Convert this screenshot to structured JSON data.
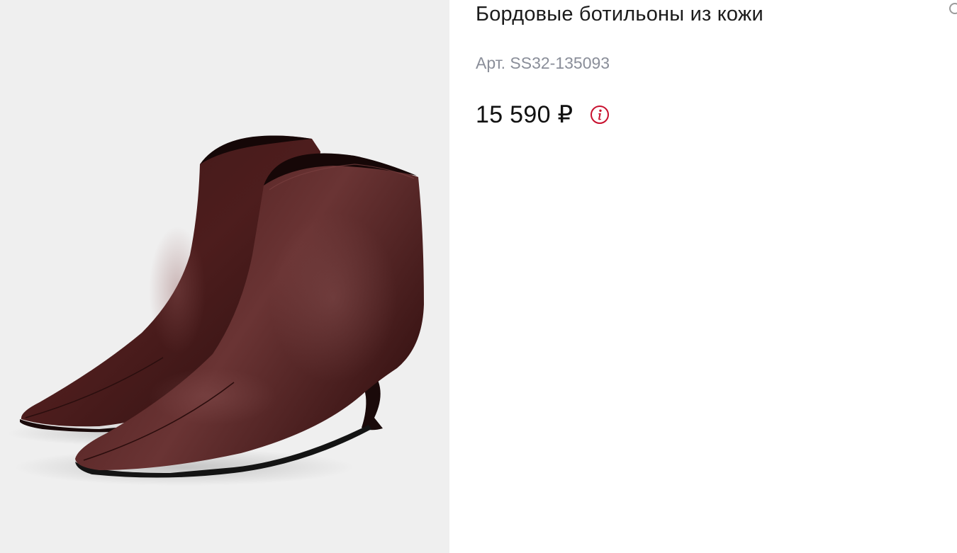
{
  "product": {
    "title": "Бордовые ботильоны из кожи",
    "sku_text": "Арт. SS32-135093",
    "price_text": "15 590 ₽",
    "image_icon": "product-photo-ankle-boots",
    "info_icon": "info-icon",
    "accent_color": "#c8102e",
    "leather_color": "#4a1c1c"
  },
  "edge_icon": "circle-icon"
}
